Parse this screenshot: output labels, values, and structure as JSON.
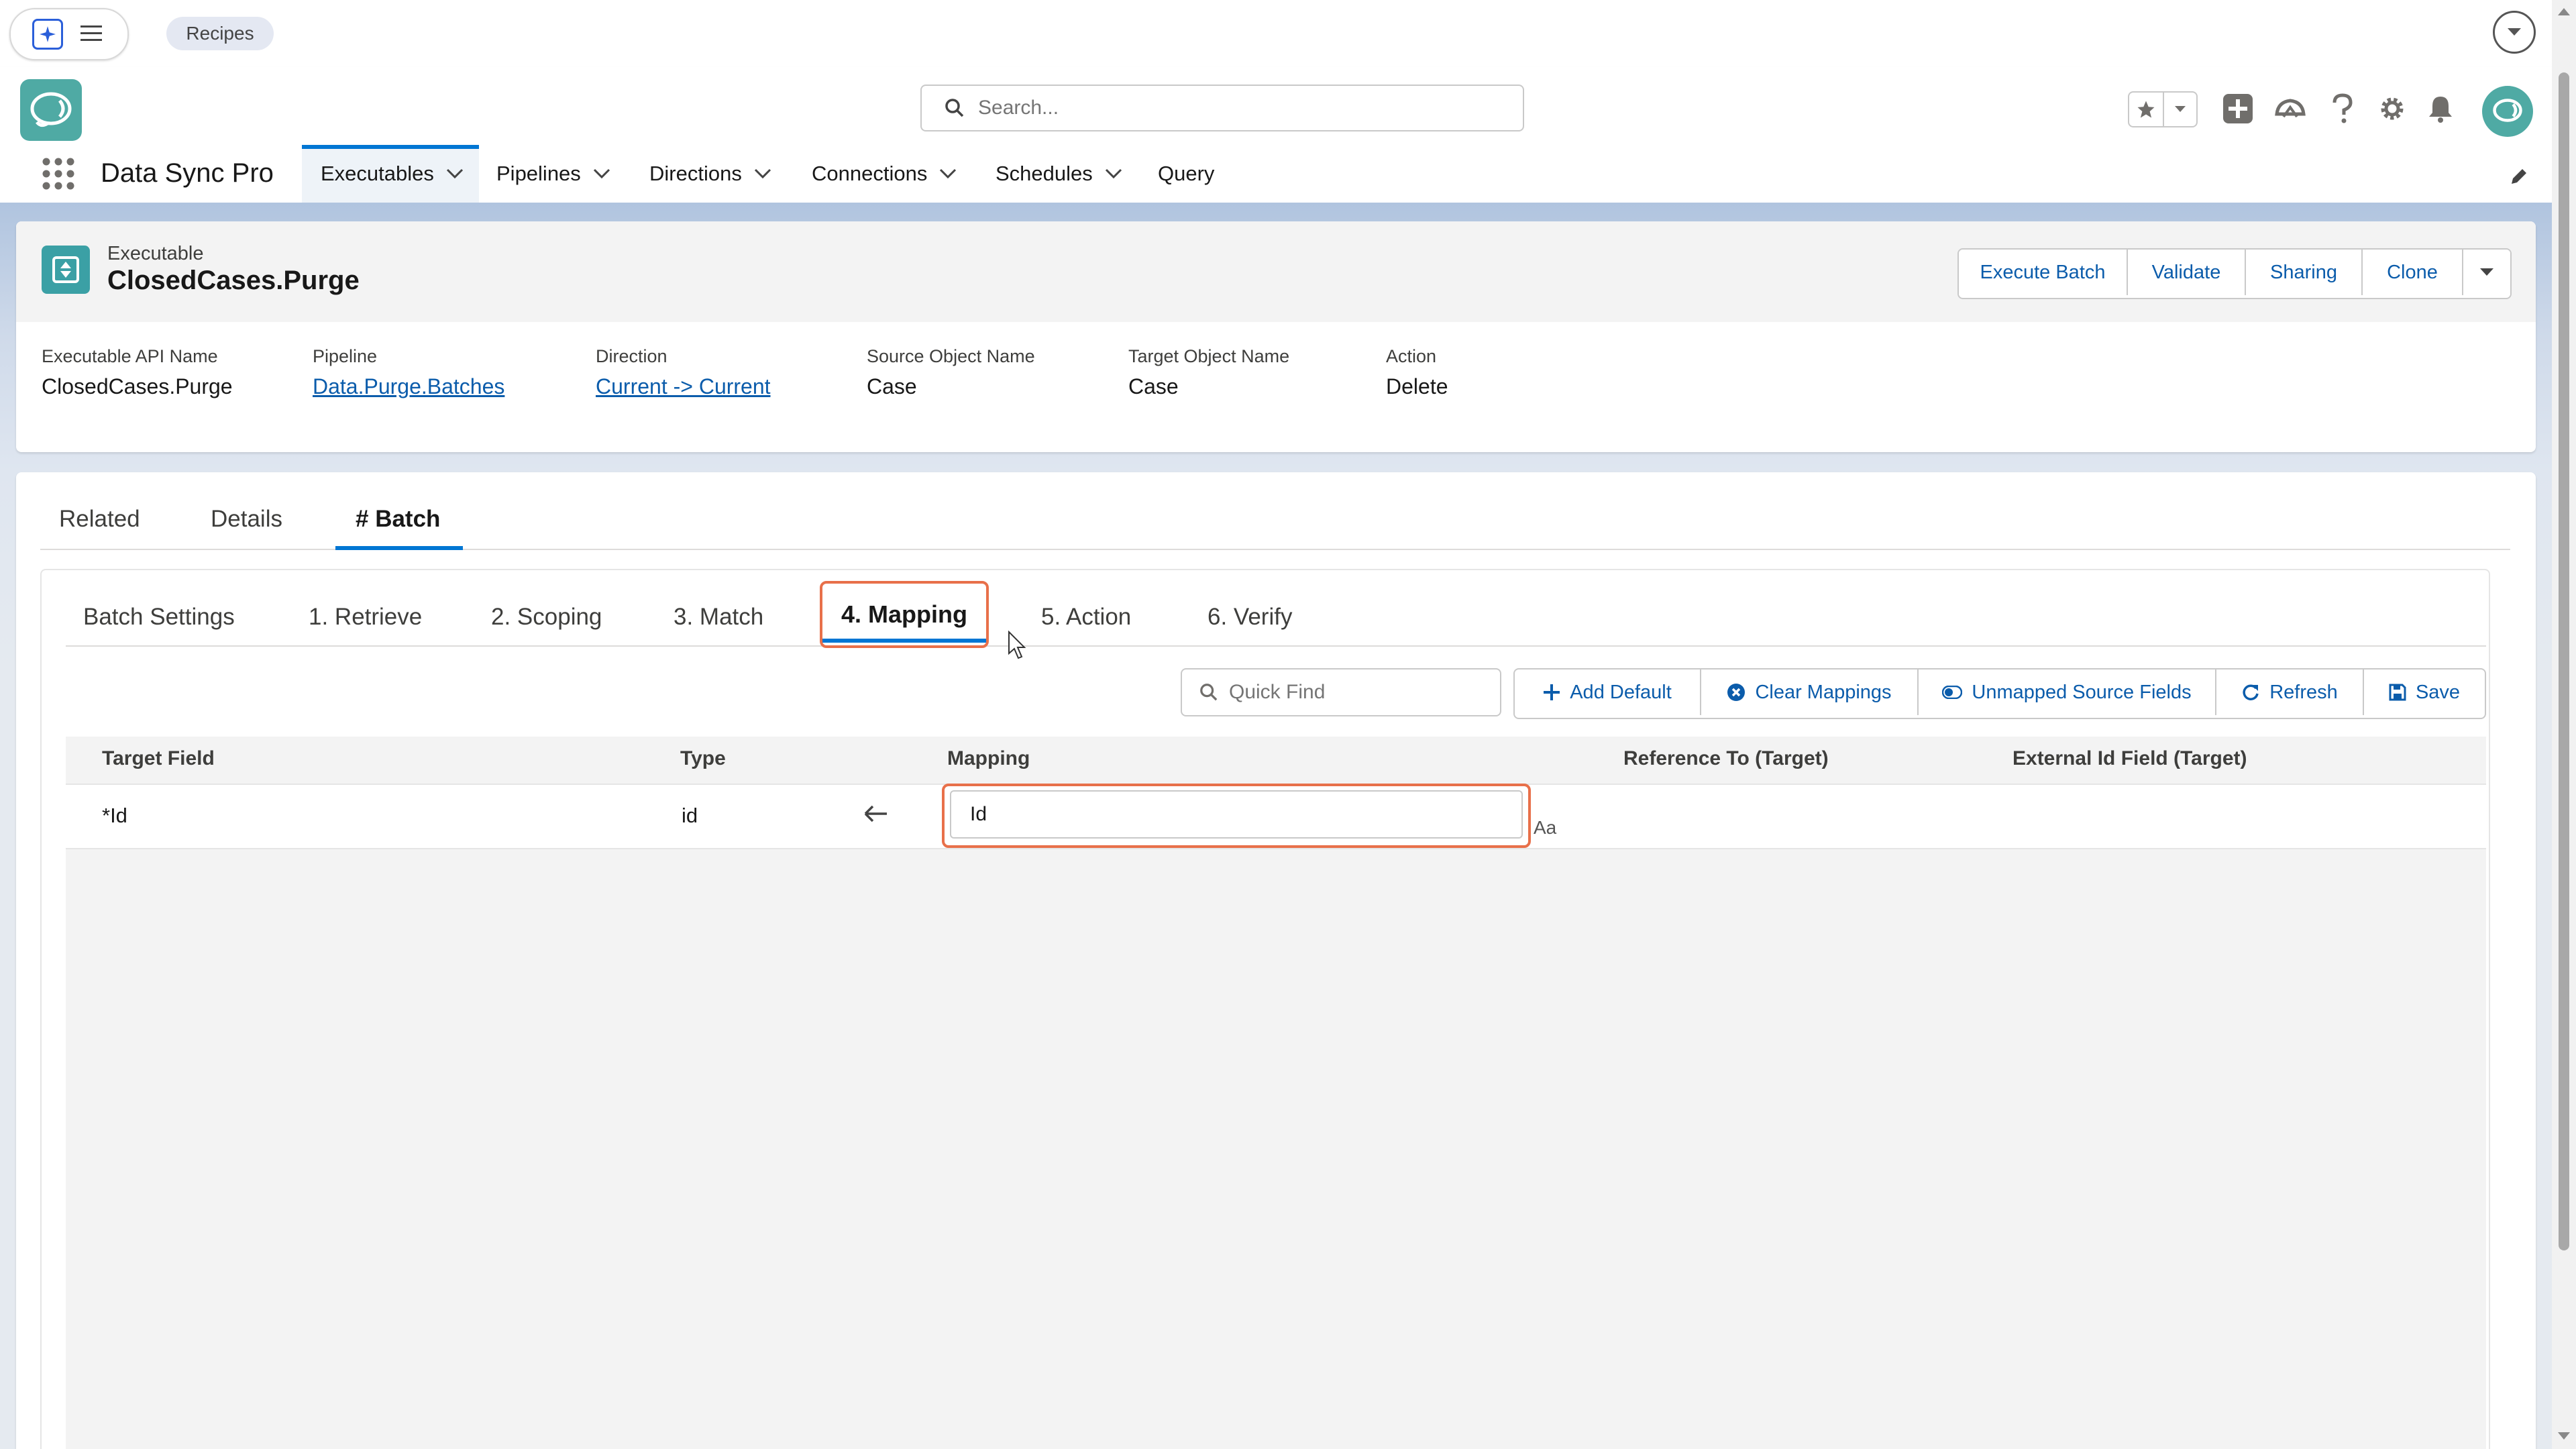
{
  "topbar": {
    "recipes_label": "Recipes"
  },
  "header": {
    "search_placeholder": "Search...",
    "app_name": "Data Sync Pro",
    "nav": [
      {
        "label": "Executables",
        "active": true,
        "has_menu": true
      },
      {
        "label": "Pipelines",
        "has_menu": true
      },
      {
        "label": "Directions",
        "has_menu": true
      },
      {
        "label": "Connections",
        "has_menu": true
      },
      {
        "label": "Schedules",
        "has_menu": true
      },
      {
        "label": "Query",
        "has_menu": false
      }
    ],
    "icons": [
      "favorites-star-icon",
      "add-icon",
      "trailhead-icon",
      "help-icon",
      "setup-gear-icon",
      "notifications-bell-icon",
      "user-avatar"
    ]
  },
  "record": {
    "object_label": "Executable",
    "name": "ClosedCases.Purge",
    "actions": [
      "Execute Batch",
      "Validate",
      "Sharing",
      "Clone"
    ],
    "fields": [
      {
        "label": "Executable API Name",
        "value": "ClosedCases.Purge",
        "link": false
      },
      {
        "label": "Pipeline",
        "value": "Data.Purge.Batches",
        "link": true
      },
      {
        "label": "Direction",
        "value": "Current -> Current",
        "link": true
      },
      {
        "label": "Source Object Name",
        "value": "Case",
        "link": false
      },
      {
        "label": "Target Object Name",
        "value": "Case",
        "link": false
      },
      {
        "label": "Action",
        "value": "Delete",
        "link": false
      }
    ]
  },
  "record_tabs": [
    "Related",
    "Details",
    "# Batch"
  ],
  "batch_tabs": [
    "Batch Settings",
    "1. Retrieve",
    "2. Scoping",
    "3. Match",
    "4. Mapping",
    "5. Action",
    "6. Verify"
  ],
  "active_batch_tab": "4. Mapping",
  "toolbar": {
    "quick_find_placeholder": "Quick Find",
    "buttons": [
      "Add Default",
      "Clear Mappings",
      "Unmapped Source Fields",
      "Refresh",
      "Save"
    ]
  },
  "table": {
    "columns": [
      "Target Field",
      "Type",
      "Mapping",
      "Reference To (Target)",
      "External Id Field (Target)"
    ],
    "rows": [
      {
        "target_field": "*Id",
        "type": "id",
        "mapping": "Id",
        "reference_to": "",
        "external_id_field": ""
      }
    ],
    "format_icon_text": "Aa"
  },
  "colors": {
    "brand_blue": "#0176d3",
    "link_blue": "#0b5cab",
    "highlight_orange": "#e8704a",
    "record_icon_teal": "#3ba0a5"
  }
}
